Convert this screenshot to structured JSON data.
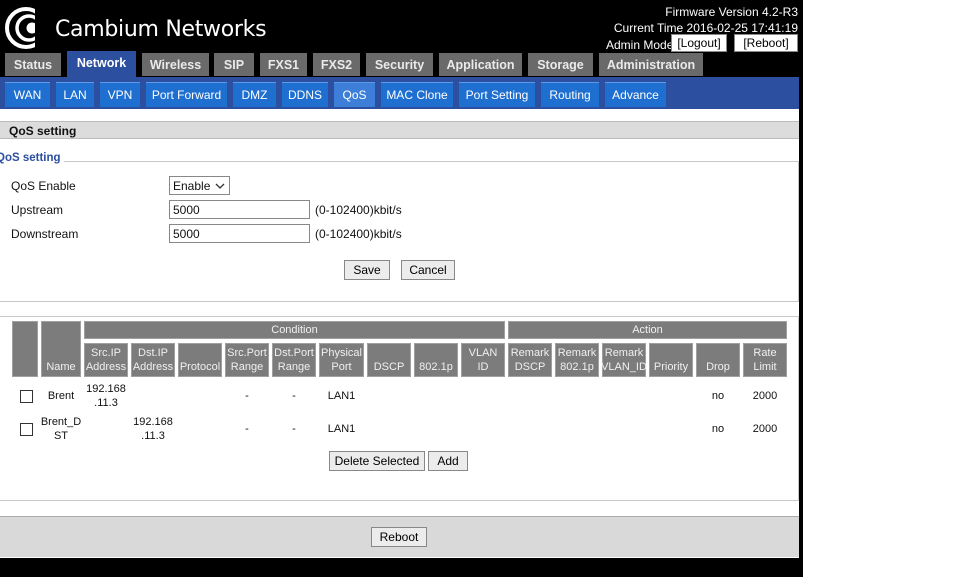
{
  "header": {
    "logo_text": "Cambium Networks",
    "firmware": "Firmware Version 4.2-R3",
    "current_time": "Current Time 2016-02-25 17:41:19",
    "admin_mode": "Admin Mode",
    "logout_label": "[Logout]",
    "reboot_label": "[Reboot]"
  },
  "main_tabs": [
    {
      "label": "Status",
      "active": false
    },
    {
      "label": "Network",
      "active": true
    },
    {
      "label": "Wireless",
      "active": false
    },
    {
      "label": "SIP",
      "active": false
    },
    {
      "label": "FXS1",
      "active": false
    },
    {
      "label": "FXS2",
      "active": false
    },
    {
      "label": "Security",
      "active": false
    },
    {
      "label": "Application",
      "active": false
    },
    {
      "label": "Storage",
      "active": false
    },
    {
      "label": "Administration",
      "active": false
    }
  ],
  "sub_tabs": [
    {
      "label": "WAN",
      "active": false
    },
    {
      "label": "LAN",
      "active": false
    },
    {
      "label": "VPN",
      "active": false
    },
    {
      "label": "Port Forward",
      "active": false
    },
    {
      "label": "DMZ",
      "active": false
    },
    {
      "label": "DDNS",
      "active": false
    },
    {
      "label": "QoS",
      "active": true
    },
    {
      "label": "MAC Clone",
      "active": false
    },
    {
      "label": "Port Setting",
      "active": false
    },
    {
      "label": "Routing",
      "active": false
    },
    {
      "label": "Advance",
      "active": false
    }
  ],
  "section_title": "QoS setting",
  "legend": "QoS setting",
  "form": {
    "qos_enable_label": "QoS Enable",
    "qos_enable_value": "Enable",
    "upstream_label": "Upstream",
    "upstream_value": "5000",
    "upstream_unit": "(0-102400)kbit/s",
    "downstream_label": "Downstream",
    "downstream_value": "5000",
    "downstream_unit": "(0-102400)kbit/s",
    "save_label": "Save",
    "cancel_label": "Cancel"
  },
  "table": {
    "group_condition": "Condition",
    "group_action": "Action",
    "headers": [
      "Name",
      "Src.IP Address",
      "Dst.IP Address",
      "Protocol",
      "Src.Port Range",
      "Dst.Port Range",
      "Physical Port",
      "DSCP",
      "802.1p",
      "VLAN ID",
      "Remark DSCP",
      "Remark 802.1p",
      "Remark VLAN_ID",
      "Priority",
      "Drop",
      "Rate Limit"
    ],
    "rows": [
      {
        "name": "Brent",
        "src_ip": "192.168 .11.3",
        "dst_ip": "",
        "src_port": "-",
        "dst_port": "-",
        "phys_port": "LAN1",
        "drop": "no",
        "rate": "2000"
      },
      {
        "name": "Brent_D ST",
        "src_ip": "",
        "dst_ip": "192.168 .11.3",
        "src_port": "-",
        "dst_port": "-",
        "phys_port": "LAN1",
        "drop": "no",
        "rate": "2000"
      }
    ],
    "delete_label": "Delete Selected",
    "add_label": "Add"
  },
  "bottom": {
    "reboot_label": "Reboot"
  }
}
